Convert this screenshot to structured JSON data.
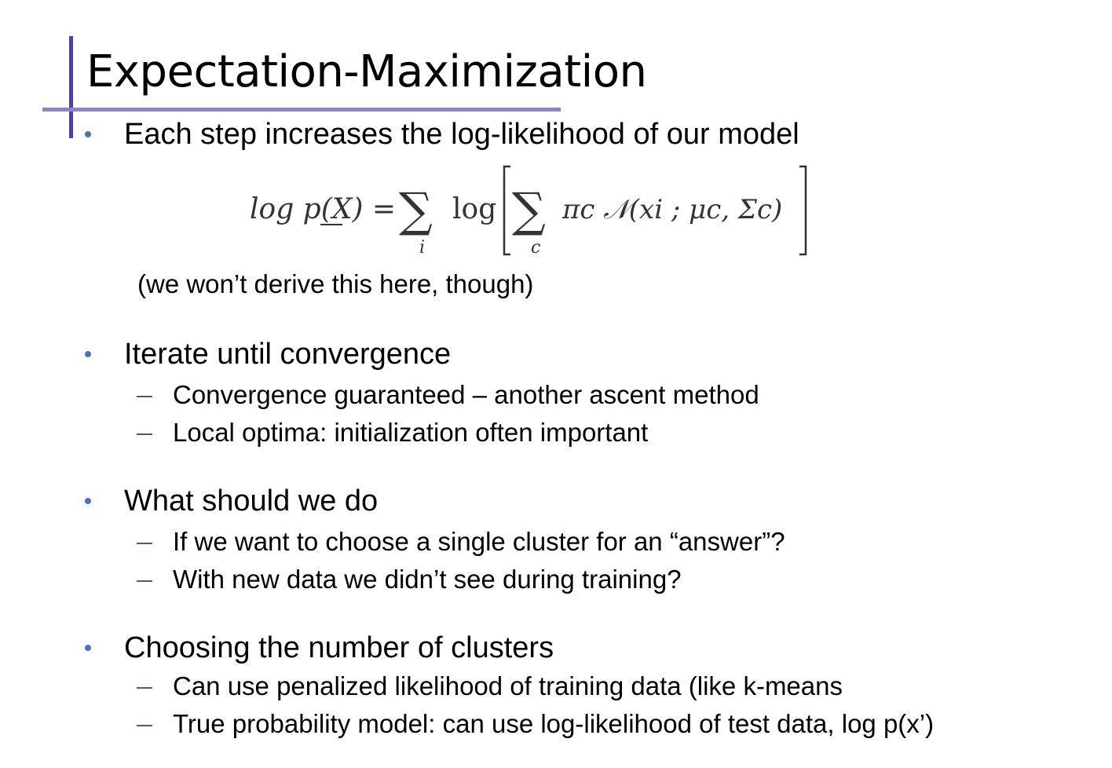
{
  "slide": {
    "title": "Expectation-Maximization",
    "accent_color": "#4a3fa6",
    "bullet_color": "#4a73b8"
  },
  "bullets": [
    {
      "text": "Each step increases the log-likelihood of our model",
      "equation": {
        "lhs": "log p(X) =",
        "sum_outer": "∑",
        "sum_outer_index": "i",
        "log_word": "log",
        "sum_inner": "∑",
        "sum_inner_index": "c",
        "rhs": "πc 𝒩(xi ; μc, Σc)"
      },
      "note": "(we won’t derive this here, though)"
    },
    {
      "text": "Iterate until convergence",
      "subitems": [
        "Convergence guaranteed – another ascent method",
        "Local optima: initialization often important"
      ]
    },
    {
      "text": "What should we do",
      "subitems": [
        "If we want to choose a single cluster for an “answer”?",
        "With new data we didn’t see during training?"
      ]
    },
    {
      "text": "Choosing the number of clusters",
      "subitems": [
        "Can use penalized likelihood of training data  (like k-means",
        "True probability model: can use log-likelihood of test data, log p(x’)"
      ]
    }
  ]
}
